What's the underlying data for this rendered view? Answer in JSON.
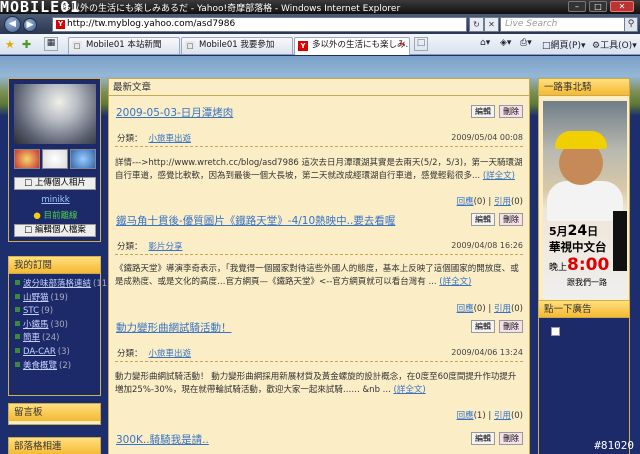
{
  "browser": {
    "title": "多以外の生活にも楽しみあるだ - Yahoo!奇摩部落格 - Windows Internet Explorer",
    "url": "http://tw.myblog.yahoo.com/asd7986",
    "search_placeholder": "Live Search",
    "tabs": [
      "Mobile01 本站新聞",
      "Mobile01 我要參加",
      "多以外の生活にも楽しみ..."
    ],
    "tools": {
      "page": "網頁(P)",
      "tools": "工具(O)"
    }
  },
  "logo": "MOBILE01",
  "profile": {
    "upload_label": "上傳個人相片",
    "username": "minikk",
    "status": "目前離線",
    "edit_label": "編輯個人檔案"
  },
  "subscriptions": {
    "heading": "我的訂閱",
    "items": [
      {
        "name": "波分味部落格連結",
        "count": "(11)"
      },
      {
        "name": "山野猫",
        "count": "(19)"
      },
      {
        "name": "STC",
        "count": "(9)"
      },
      {
        "name": "小鐵馬",
        "count": "(30)"
      },
      {
        "name": "簡車",
        "count": "(24)"
      },
      {
        "name": "DA-CAR",
        "count": "(3)"
      },
      {
        "name": "美食概覽",
        "count": "(2)"
      }
    ]
  },
  "message_board": "留言板",
  "friends": "部落格相連",
  "main": {
    "heading": "最新文章",
    "edit_label": "編輯",
    "delete_label": "刪除",
    "category_label": "分類：",
    "more_label": "詳全文",
    "reply_label": "回應",
    "trackback_label": "引用",
    "posts": [
      {
        "title": "2009-05-03-日月潭烤肉",
        "category": "小旅車出遊",
        "date": "2009/05/04 00:08",
        "excerpt": "詳情--->http://www.wretch.cc/blog/asd7986 這次去日月潭環湖其實是去兩天(5/2，5/3)，第一天騎環湖自行車道，感覺比軟軟，因為到最後一個大長坡，第二天就改成經環湖自行車道，感覺輕鬆很多...",
        "replies": "(0)",
        "trackbacks": "(0)"
      },
      {
        "title": "鐵马角十貫後-優質圖片《鐵路天堂》-4/10熱映中..要去看喔",
        "category": "影片分享",
        "date": "2009/04/08 16:26",
        "excerpt": "《鐵路天堂》導演李奇表示，「我覺得一個國家對待這些外國人的態度，基本上反映了這個國家的開放度、或是成熟度、或是文化的高度…官方網頁—《鐵路天堂》<--官方網頁就可以看台灣有 ...",
        "replies": "(0)",
        "trackbacks": "(0)"
      },
      {
        "title": "動力變形曲網試騎活動！",
        "category": "小旅車出遊",
        "date": "2009/04/06 13:24",
        "excerpt": "動力變形曲網試騎活動！ 動力變形曲網採用新展材質及黃金螺旋的設計概念，在0度至60度間提升作功提升増加25%-30%，現在就帶輪試騎活動，歡迎大家一起來試騎…… &nb ...",
        "replies": "(1)",
        "trackbacks": "(0)"
      },
      {
        "title": "300K..騎騎我是請.."
      }
    ]
  },
  "promo": {
    "heading": "一路事北騎",
    "date_prefix": "5月",
    "date_day": "24",
    "date_suffix": "日",
    "channel": "華視中文台",
    "time_prefix": "晚上",
    "time": "8:00",
    "tagline": "跟我們一路"
  },
  "ad": {
    "heading": "點一下廣告"
  },
  "watermark": "#81020"
}
